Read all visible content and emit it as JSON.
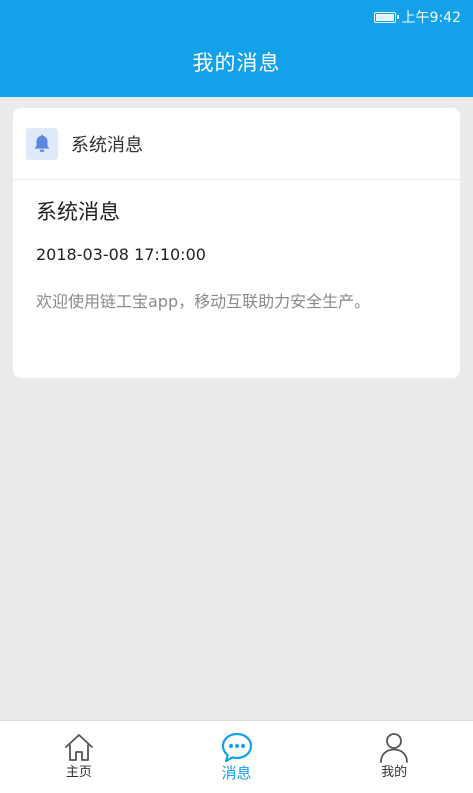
{
  "status_bar": {
    "time": "上午9:42"
  },
  "header": {
    "title": "我的消息"
  },
  "card": {
    "header_title": "系统消息",
    "message": {
      "title": "系统消息",
      "timestamp": "2018-03-08 17:10:00",
      "body": "欢迎使用链工宝app，移动互联助力安全生产。"
    }
  },
  "tabbar": {
    "tabs": [
      {
        "label": "主页",
        "icon": "home-icon",
        "active": false
      },
      {
        "label": "消息",
        "icon": "message-icon",
        "active": true
      },
      {
        "label": "我的",
        "icon": "person-icon",
        "active": false
      }
    ]
  },
  "colors": {
    "primary": "#13a2ea",
    "background": "#ebebeb",
    "card": "#ffffff",
    "muted_text": "#8a8a8a",
    "bell": "#5a88e0"
  }
}
